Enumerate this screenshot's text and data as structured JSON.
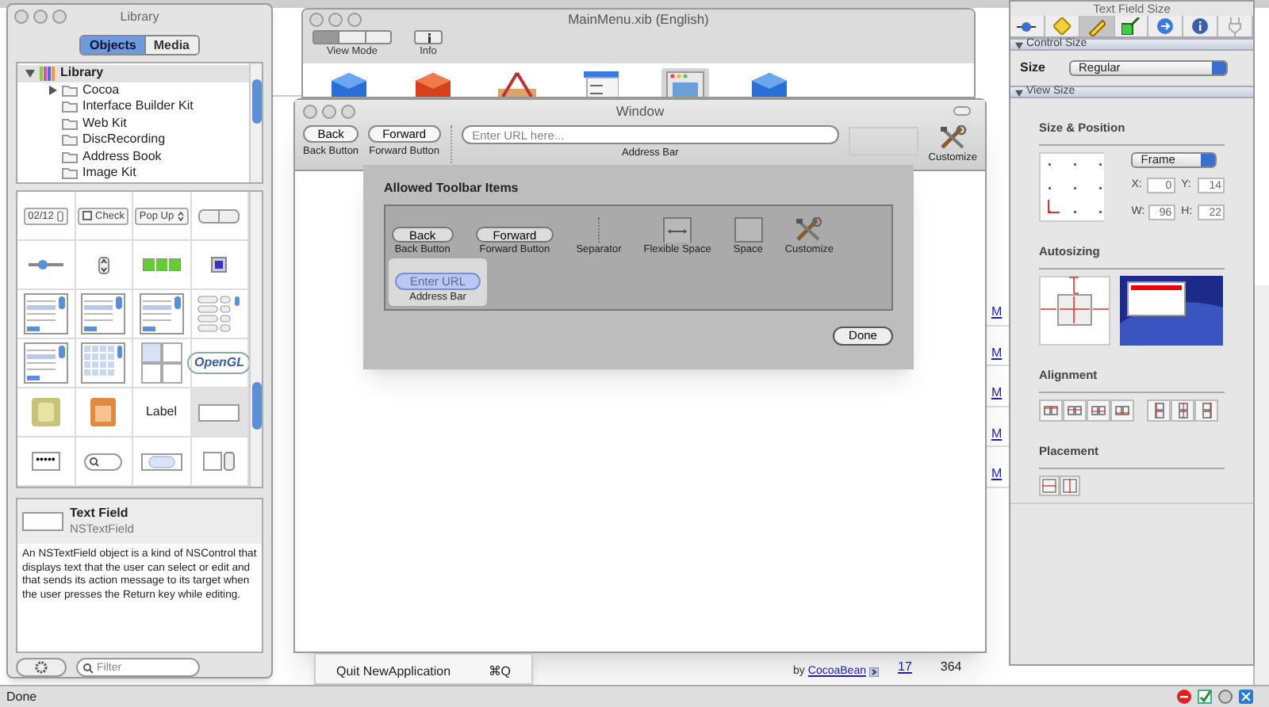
{
  "library": {
    "title": "Library",
    "tabs": [
      {
        "label": "Objects",
        "selected": true
      },
      {
        "label": "Media",
        "selected": false
      }
    ],
    "tree": [
      {
        "label": "Library",
        "expanded": true,
        "children": [
          {
            "label": "Cocoa",
            "expanded": false
          },
          {
            "label": "Interface Builder Kit"
          },
          {
            "label": "Web Kit"
          },
          {
            "label": "DiscRecording"
          },
          {
            "label": "Address Book"
          },
          {
            "label": "Image Kit"
          }
        ]
      }
    ],
    "objects": [
      {
        "kind": "date-picker",
        "label": "02/12",
        "selected": false
      },
      {
        "kind": "checkbox",
        "label": "Check",
        "selected": false
      },
      {
        "kind": "popup",
        "label": "Pop Up",
        "selected": false
      },
      {
        "kind": "segmented",
        "selected": false
      },
      {
        "kind": "slider",
        "selected": false
      },
      {
        "kind": "stepper",
        "selected": false
      },
      {
        "kind": "level-indicator",
        "selected": false
      },
      {
        "kind": "color-well",
        "selected": false
      },
      {
        "kind": "table-view",
        "selected": false
      },
      {
        "kind": "outline-view",
        "selected": false
      },
      {
        "kind": "browser",
        "selected": false
      },
      {
        "kind": "matrix",
        "selected": false
      },
      {
        "kind": "scroll-list",
        "selected": false
      },
      {
        "kind": "collection-grid",
        "selected": false
      },
      {
        "kind": "split-view",
        "selected": false
      },
      {
        "kind": "opengl",
        "label": "OpenGL",
        "selected": false
      },
      {
        "kind": "number-formatter",
        "selected": false
      },
      {
        "kind": "date-formatter",
        "selected": false
      },
      {
        "kind": "label",
        "label": "Label",
        "selected": false
      },
      {
        "kind": "text-field",
        "selected": true
      },
      {
        "kind": "secure-field",
        "label": "•••••",
        "selected": false
      },
      {
        "kind": "search-field",
        "selected": false
      },
      {
        "kind": "token-field",
        "selected": false
      },
      {
        "kind": "number-stepper",
        "selected": false
      }
    ],
    "detail": {
      "title": "Text Field",
      "class": "NSTextField",
      "description": "An NSTextField object is a kind of NSControl that displays text that the user can select or edit and that sends its action message to its target when the user presses the Return key while editing."
    },
    "filter": {
      "placeholder": "Filter"
    }
  },
  "xib": {
    "title": "MainMenu.xib (English)",
    "toolbar": [
      {
        "kind": "view-mode",
        "label": "View Mode"
      },
      {
        "kind": "info",
        "label": "Info"
      }
    ],
    "objects": [
      {
        "kind": "blue-cube",
        "selected": false
      },
      {
        "kind": "red-cube",
        "selected": false
      },
      {
        "kind": "app",
        "selected": false
      },
      {
        "kind": "menu",
        "selected": false
      },
      {
        "kind": "window",
        "selected": true
      },
      {
        "kind": "blue-cube",
        "selected": false
      }
    ]
  },
  "window": {
    "title": "Window",
    "toolbar": [
      {
        "kind": "button",
        "text": "Back",
        "label": "Back Button"
      },
      {
        "kind": "button",
        "text": "Forward",
        "label": "Forward Button"
      },
      {
        "kind": "separator"
      },
      {
        "kind": "field",
        "placeholder": "Enter URL here...",
        "label": "Address Bar"
      },
      {
        "kind": "slot"
      },
      {
        "kind": "customize",
        "label": "Customize"
      }
    ]
  },
  "sheet": {
    "title": "Allowed Toolbar Items",
    "items": [
      {
        "kind": "button",
        "text": "Back",
        "label": "Back Button",
        "selected": false
      },
      {
        "kind": "button",
        "text": "Forward",
        "label": "Forward Button",
        "selected": false
      },
      {
        "kind": "separator",
        "label": "Separator",
        "selected": false
      },
      {
        "kind": "flexible-space",
        "label": "Flexible Space",
        "selected": false
      },
      {
        "kind": "space",
        "label": "Space",
        "selected": false
      },
      {
        "kind": "customize",
        "label": "Customize",
        "selected": false
      },
      {
        "kind": "field",
        "text": "Enter URL",
        "label": "Address Bar",
        "selected": true
      }
    ],
    "done": "Done"
  },
  "inspector": {
    "title": "Text Field Size",
    "tabs": [
      {
        "kind": "attributes",
        "selected": false
      },
      {
        "kind": "effects",
        "selected": false
      },
      {
        "kind": "size",
        "selected": true
      },
      {
        "kind": "connections",
        "selected": false
      },
      {
        "kind": "bindings",
        "selected": false
      },
      {
        "kind": "identity",
        "selected": false
      },
      {
        "kind": "plugin",
        "selected": false
      }
    ],
    "sections": [
      {
        "kind": "control-size",
        "title": "Control Size",
        "expanded": true,
        "size_label": "Size",
        "size_value": "Regular"
      },
      {
        "kind": "view-size",
        "title": "View Size",
        "expanded": true,
        "size_position": "Size & Position",
        "frame": "Frame",
        "fields": [
          {
            "label": "X:",
            "value": "0"
          },
          {
            "label": "Y:",
            "value": "14"
          },
          {
            "label": "W:",
            "value": "96"
          },
          {
            "label": "H:",
            "value": "22"
          }
        ],
        "autosizing": "Autosizing",
        "alignment": "Alignment",
        "placement": "Placement"
      }
    ]
  },
  "menu_item": {
    "label": "Quit NewApplication",
    "shortcut": "⌘Q"
  },
  "forum": {
    "author_prefix": "by",
    "author": "CocoaBean",
    "replies": "17",
    "views": "364",
    "links": [
      "M",
      "M",
      "M",
      "M",
      "M"
    ]
  },
  "status_bar": {
    "text": "Done"
  }
}
